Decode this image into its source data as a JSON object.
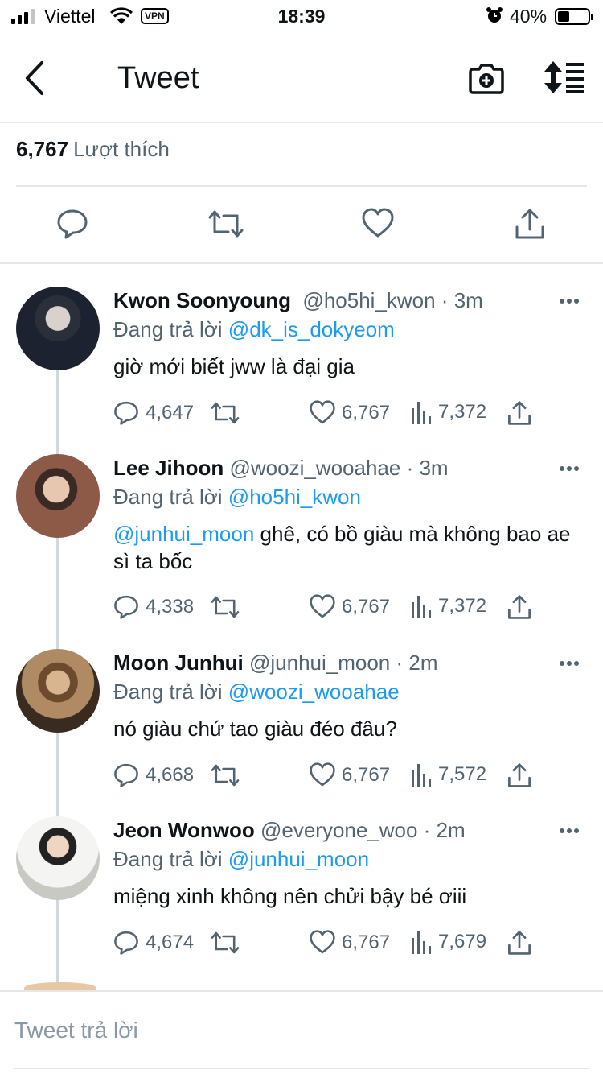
{
  "status": {
    "carrier": "Viettel",
    "vpn": "VPN",
    "time": "18:39",
    "battery": "40%"
  },
  "nav": {
    "title": "Tweet"
  },
  "tweet": {
    "likes_count": "6,767",
    "likes_label": "Lượt thích"
  },
  "replying_label": "Đang trả lời",
  "replies": [
    {
      "name": "Kwon Soonyoung",
      "handle": "@ho5hi_kwon · 3m",
      "replying_to": "@dk_is_dokyeom",
      "mention": "",
      "text": "giờ mới biết jww là đại gia",
      "comments": "4,647",
      "likes": "6,767",
      "views": "7,372"
    },
    {
      "name": "Lee Jihoon",
      "handle": "@woozi_wooahae · 3m",
      "replying_to": "@ho5hi_kwon",
      "mention": "@junhui_moon",
      "text": " ghê, có bồ giàu mà không bao ae sì ta bốc",
      "comments": "4,338",
      "likes": "6,767",
      "views": "7,372"
    },
    {
      "name": "Moon Junhui",
      "handle": "@junhui_moon · 2m",
      "replying_to": "@woozi_wooahae",
      "mention": "",
      "text": "nó giàu chứ tao giàu đéo đâu?",
      "comments": "4,668",
      "likes": "6,767",
      "views": "7,572"
    },
    {
      "name": "Jeon Wonwoo",
      "handle": "@everyone_woo · 2m",
      "replying_to": "@junhui_moon",
      "mention": "",
      "text": "miệng xinh không nên chửi bậy bé ơiii",
      "comments": "4,674",
      "likes": "6,767",
      "views": "7,679"
    }
  ],
  "composer": {
    "placeholder": "Tweet trả lời"
  },
  "colors": {
    "accent": "#1d9bf0",
    "muted": "#536471",
    "divider": "#e6e6e6"
  }
}
